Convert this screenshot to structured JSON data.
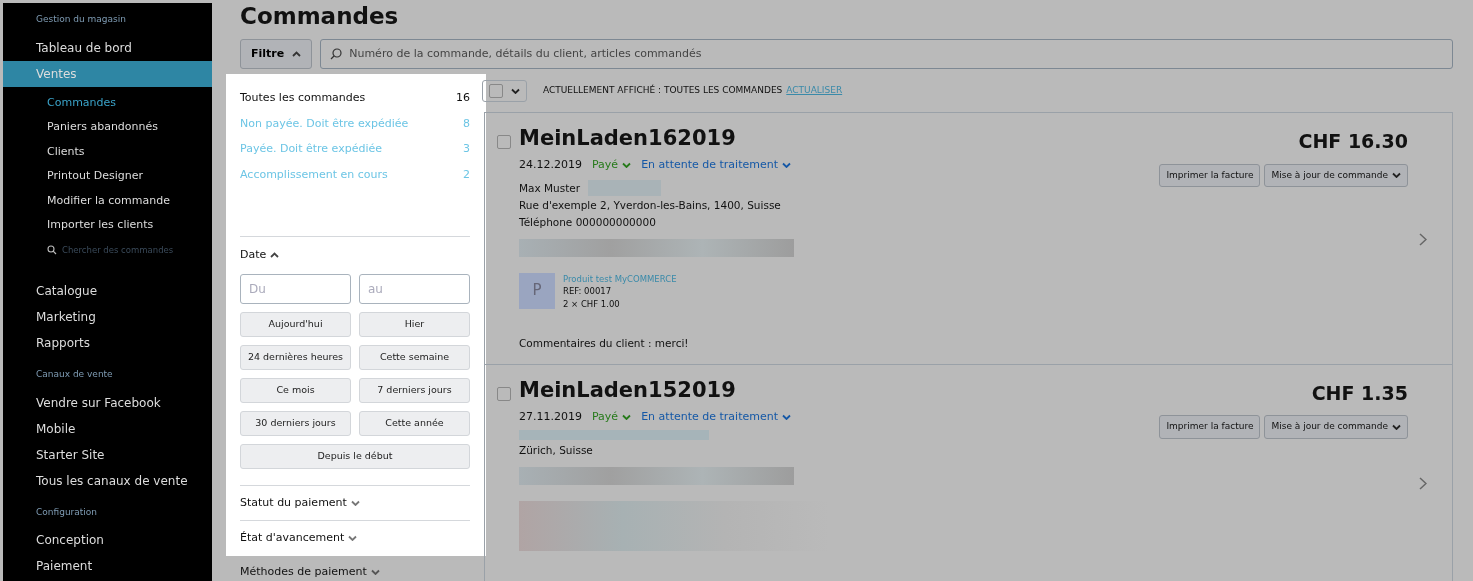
{
  "sidebar": {
    "sections": [
      {
        "heading": "Gestion du magasin",
        "items": [
          {
            "label": "Tableau de bord",
            "selected": false
          },
          {
            "label": "Ventes",
            "selected": true,
            "children": [
              {
                "label": "Commandes",
                "selected": true
              },
              {
                "label": "Paniers abandonnés",
                "selected": false
              },
              {
                "label": "Clients",
                "selected": false
              },
              {
                "label": "Printout Designer",
                "selected": false
              },
              {
                "label": "Modifier la commande",
                "selected": false
              },
              {
                "label": "Importer les clients",
                "selected": false
              }
            ],
            "search": {
              "placeholder": "Chercher des commandes"
            }
          },
          {
            "label": "Catalogue",
            "selected": false
          },
          {
            "label": "Marketing",
            "selected": false
          },
          {
            "label": "Rapports",
            "selected": false
          }
        ]
      },
      {
        "heading": "Canaux de vente",
        "items": [
          {
            "label": "Vendre sur Facebook",
            "selected": false
          },
          {
            "label": "Mobile",
            "selected": false
          },
          {
            "label": "Starter Site",
            "selected": false
          },
          {
            "label": "Tous les canaux de vente",
            "selected": false
          }
        ]
      },
      {
        "heading": "Configuration",
        "items": [
          {
            "label": "Conception",
            "selected": false
          },
          {
            "label": "Paiement",
            "selected": false
          }
        ]
      }
    ]
  },
  "page_title": "Commandes",
  "filter_button": {
    "label": "Filtre",
    "expanded": true
  },
  "search": {
    "placeholder": "Numéro de la commande, détails du client, articles commandés"
  },
  "filter_panel": {
    "views": [
      {
        "label": "Toutes les commandes",
        "count": "16",
        "selected": true
      },
      {
        "label": "Non payée. Doit être expédiée",
        "count": "8",
        "selected": false
      },
      {
        "label": "Payée. Doit être expédiée",
        "count": "3",
        "selected": false
      },
      {
        "label": "Accomplissement en cours",
        "count": "2",
        "selected": false
      }
    ],
    "date": {
      "title": "Date",
      "expanded": true,
      "from_placeholder": "Du",
      "to_placeholder": "au",
      "ranges": [
        "Aujourd'hui",
        "Hier",
        "24 dernières heures",
        "Cette semaine",
        "Ce mois",
        "7 derniers jours",
        "30 derniers jours",
        "Cette année",
        "Depuis le début"
      ]
    },
    "sections": [
      {
        "title": "Statut du paiement",
        "expanded": false
      },
      {
        "title": "État d'avancement",
        "expanded": false
      }
    ],
    "below": [
      {
        "title": "Méthodes de paiement",
        "expanded": false
      }
    ]
  },
  "toolbar": {
    "status": "ACTUELLEMENT AFFICHÉ : TOUTES LES COMMANDES",
    "refresh": "ACTUALISER"
  },
  "orders": [
    {
      "number": "MeinLaden162019",
      "checked": false,
      "date": "24.12.2019",
      "payment": "Payé",
      "fulfillment": "En attente de traitement",
      "total": "CHF 16.30",
      "customer_lines": [
        "Max Muster",
        "Rue d'exemple 2, Yverdon-les-Bains, 1400, Suisse",
        "Téléphone 000000000000"
      ],
      "items": [
        {
          "thumb": "P",
          "name": "Produit test MyCOMMERCE",
          "ref": "REF: 00017",
          "qty": "2 × CHF 1.00"
        }
      ],
      "comment": "Commentaires du client : merci!",
      "buttons": [
        "Imprimer la facture",
        "Mise à jour de commande"
      ]
    },
    {
      "number": "MeinLaden152019",
      "checked": false,
      "date": "27.11.2019",
      "payment": "Payé",
      "fulfillment": "En attente de traitement",
      "total": "CHF 1.35",
      "customer_lines": [
        "Zürich, Suisse"
      ],
      "buttons": [
        "Imprimer la facture",
        "Mise à jour de commande"
      ]
    }
  ]
}
